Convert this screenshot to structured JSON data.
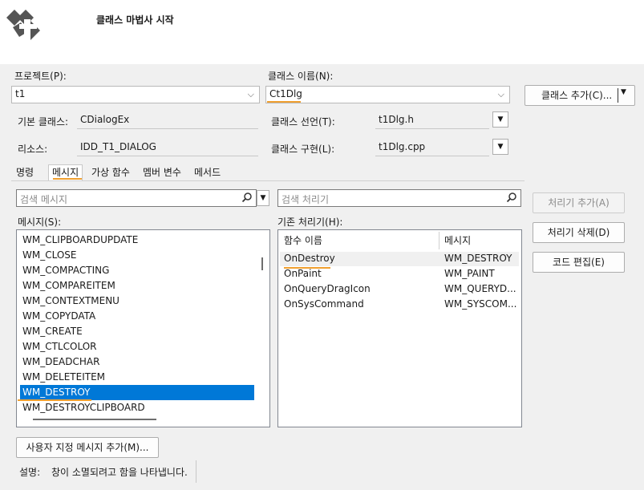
{
  "header": {
    "title": "클래스 마법사 시작",
    "logo_icon": "class-wizard-logo"
  },
  "project": {
    "label": "프로젝트(P):",
    "value": "t1"
  },
  "class_name": {
    "label": "클래스 이름(N):",
    "value": "Ct1Dlg"
  },
  "add_class_button": {
    "label": "클래스 추가(C)..."
  },
  "base_class": {
    "label": "기본 클래스:",
    "value": "CDialogEx"
  },
  "resource": {
    "label": "리소스:",
    "value": "IDD_T1_DIALOG"
  },
  "class_declaration": {
    "label": "클래스 선언(T):",
    "value": "t1Dlg.h"
  },
  "class_implementation": {
    "label": "클래스 구현(L):",
    "value": "t1Dlg.cpp"
  },
  "tabs": [
    {
      "label": "명령"
    },
    {
      "label": "메시지"
    },
    {
      "label": "가상 함수"
    },
    {
      "label": "멤버 변수"
    },
    {
      "label": "메서드"
    }
  ],
  "search_messages": {
    "placeholder": "검색 메시지"
  },
  "search_handlers": {
    "placeholder": "검색 처리기"
  },
  "messages_label": "메시지(S):",
  "handlers_label": "기존 처리기(H):",
  "messages": [
    "WM_CLIPBOARDUPDATE",
    "WM_CLOSE",
    "WM_COMPACTING",
    "WM_COMPAREITEM",
    "WM_CONTEXTMENU",
    "WM_COPYDATA",
    "WM_CREATE",
    "WM_CTLCOLOR",
    "WM_DEADCHAR",
    "WM_DELETEITEM",
    "WM_DESTROY",
    "WM_DESTROYCLIPBOARD"
  ],
  "selected_message": "WM_DESTROY",
  "handlers_columns": {
    "function": "함수 이름",
    "message": "메시지"
  },
  "handlers": [
    {
      "function": "OnDestroy",
      "message": "WM_DESTROY"
    },
    {
      "function": "OnPaint",
      "message": "WM_PAINT"
    },
    {
      "function": "OnQueryDragIcon",
      "message": "WM_QUERYD..."
    },
    {
      "function": "OnSysCommand",
      "message": "WM_SYSCOM..."
    }
  ],
  "buttons": {
    "add_handler": "처리기 추가(A)",
    "delete_handler": "처리기 삭제(D)",
    "edit_code": "코드 편집(E)",
    "add_custom_message": "사용자 지정 메시지 추가(M)..."
  },
  "description": {
    "label": "설명:",
    "text": "창이 소멸되려고 함을 나타냅니다."
  },
  "colors": {
    "selection": "#0078d7",
    "highlight_underline": "#f0a030"
  }
}
